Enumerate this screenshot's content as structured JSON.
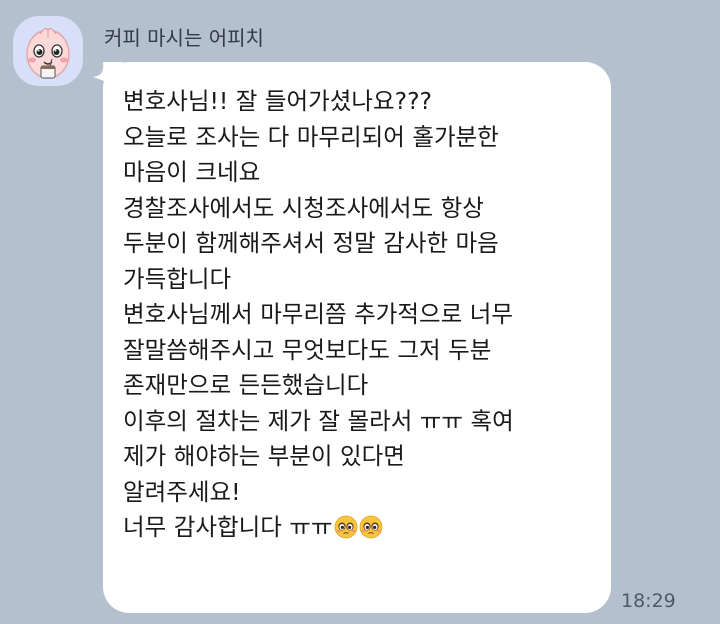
{
  "chat": {
    "sender_name": "커피 마시는 어피치",
    "avatar_icon": "apeach-character-icon",
    "message_lines": [
      "변호사님!! 잘 들어가셨나요???",
      "오늘로 조사는 다 마무리되어 홀가분한",
      "마음이 크네요",
      "경찰조사에서도 시청조사에서도 항상",
      "두분이 함께해주셔서 정말 감사한 마음",
      "가득합니다",
      "변호사님께서 마무리쯤 추가적으로 너무",
      "잘말씀해주시고 무엇보다도 그저 두분",
      "존재만으로 든든했습니다",
      "이후의 절차는 제가 잘 몰라서 ㅠㅠ 혹여",
      "제가 해야하는 부분이 있다면",
      "알려주세요!",
      "너무 감사합니다 ㅠㅠ"
    ],
    "last_line_emojis": [
      "pleading-face-emoji",
      "pleading-face-emoji"
    ],
    "time": "18:29",
    "colors": {
      "background": "#b4c0cd",
      "bubble": "#ffffff",
      "avatar_background": "#d7dff9"
    }
  }
}
